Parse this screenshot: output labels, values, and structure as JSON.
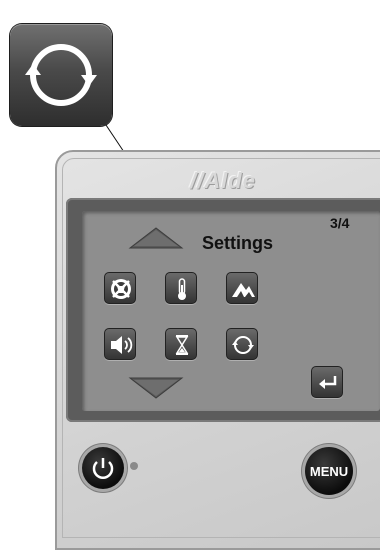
{
  "callout": {
    "icon": "refresh-cycle-icon"
  },
  "device": {
    "brand": "//Alde",
    "screen": {
      "page_indicator": "3/4",
      "title": "Settings",
      "nav": {
        "up_icon": "arrow-up-icon",
        "down_icon": "arrow-down-icon"
      },
      "icons": [
        "no-drinking-water-icon",
        "thermometer-icon",
        "mountain-altitude-icon",
        "speaker-volume-icon",
        "hourglass-timer-icon",
        "refresh-cycle-icon"
      ],
      "enter_icon": "enter-return-icon"
    },
    "buttons": {
      "power_icon": "power-icon",
      "menu_label": "MENU"
    }
  },
  "colors": {
    "housing": "#d6d6d6",
    "screen": "#8e8e8e",
    "icon_button": "#4a4a4a",
    "button_black": "#111111"
  }
}
